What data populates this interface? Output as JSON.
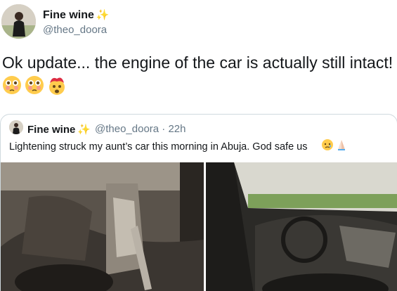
{
  "tweet": {
    "author_name": "Fine wine",
    "author_handle": "@theo_doora",
    "text": "Ok update... the engine of the car is actually still intact!"
  },
  "quoted_tweet": {
    "author_name": "Fine wine",
    "author_handle_time": "@theo_doora · 22h",
    "text": "Lightening struck my aunt’s car this morning in Abuja. God safe us"
  },
  "icons": {
    "author_badge": "sparkles-icon",
    "emoji_1": "flushed-face-icon",
    "emoji_2": "flushed-face-icon",
    "emoji_3": "exploding-head-icon",
    "quote_emoji_1": "sad-face-icon",
    "quote_emoji_2": "praying-hands-icon"
  },
  "colors": {
    "text": "#14171a",
    "secondary": "#657786",
    "border": "#cfd9de",
    "sparkle": "#f5c33b"
  }
}
